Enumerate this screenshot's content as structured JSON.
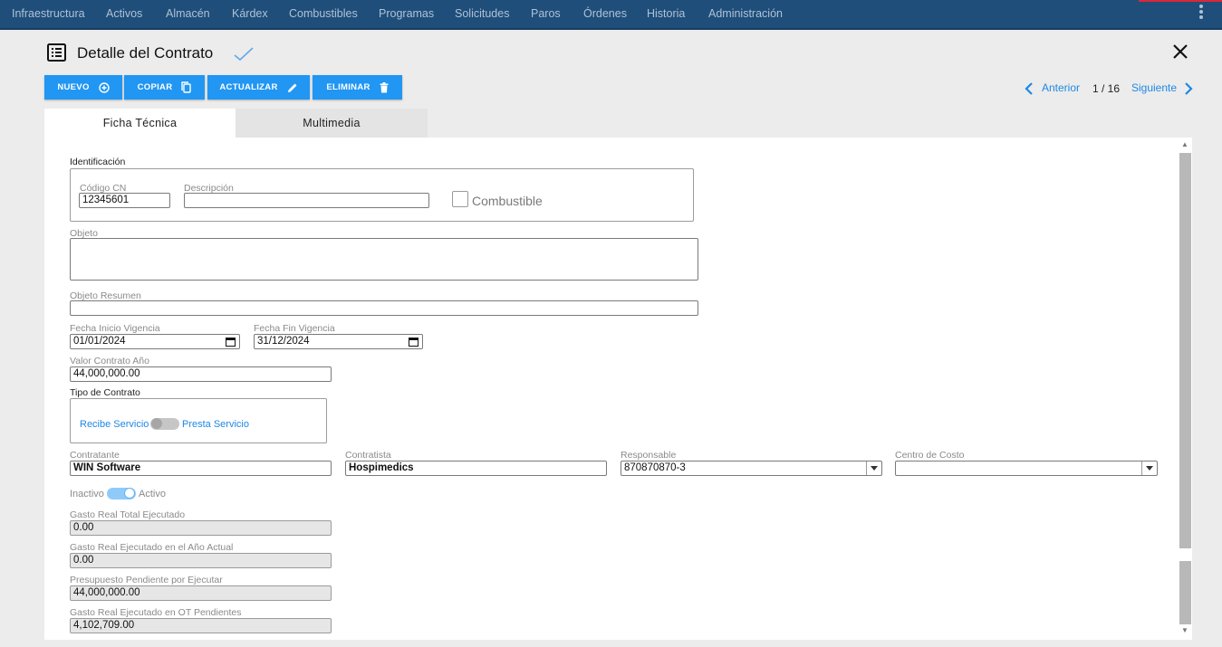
{
  "nav": {
    "items": [
      "Infraestructura",
      "Activos",
      "Almacén",
      "Kárdex",
      "Combustibles",
      "Programas",
      "Solicitudes",
      "Paros",
      "Órdenes",
      "Historia",
      "Administración"
    ]
  },
  "header": {
    "title": "Detalle del Contrato"
  },
  "toolbar": {
    "nuevo": "NUEVO",
    "copiar": "COPIAR",
    "actualizar": "ACTUALIZAR",
    "eliminar": "ELIMINAR"
  },
  "pager": {
    "prev": "Anterior",
    "count": "1 / 16",
    "next": "Siguiente"
  },
  "tabs": [
    "Ficha Técnica",
    "Multimedia"
  ],
  "form": {
    "identificacion_label": "Identificación",
    "codigo_label": "Código CN",
    "codigo_value": "12345601",
    "descripcion_label": "Descripción",
    "descripcion_value": "",
    "combustible_label": "Combustible",
    "objeto_label": "Objeto",
    "objeto_value": "",
    "objeto_resumen_label": "Objeto Resumen",
    "objeto_resumen_value": "",
    "fecha_inicio_label": "Fecha Inicio Vigencia",
    "fecha_inicio_value": "01/01/2024",
    "fecha_fin_label": "Fecha Fin Vigencia",
    "fecha_fin_value": "31/12/2024",
    "valor_label": "Valor Contrato Año",
    "valor_value": "44,000,000.00",
    "tipo_label": "Tipo de Contrato",
    "recibe_label": "Recibe Servicio",
    "presta_label": "Presta Servicio",
    "contratante_label": "Contratante",
    "contratante_value": "WIN Software",
    "contratista_label": "Contratista",
    "contratista_value": "Hospimedics",
    "responsable_label": "Responsable",
    "responsable_value": "870870870-3",
    "centro_label": "Centro de Costo",
    "centro_value": "",
    "inactivo_label": "Inactivo",
    "activo_label": "Activo",
    "gasto_total_label": "Gasto Real Total Ejecutado",
    "gasto_total_value": "0.00",
    "gasto_anio_label": "Gasto Real Ejecutado en el Año Actual",
    "gasto_anio_value": "0.00",
    "presupuesto_label": "Presupuesto Pendiente por Ejecutar",
    "presupuesto_value": "44,000,000.00",
    "gasto_ot_label": "Gasto Real Ejecutado en OT Pendientes",
    "gasto_ot_value": "4,102,709.00"
  },
  "colors": {
    "nav_bg": "#1f4e7a",
    "accent": "#2196f3",
    "link": "#1e88e5"
  }
}
